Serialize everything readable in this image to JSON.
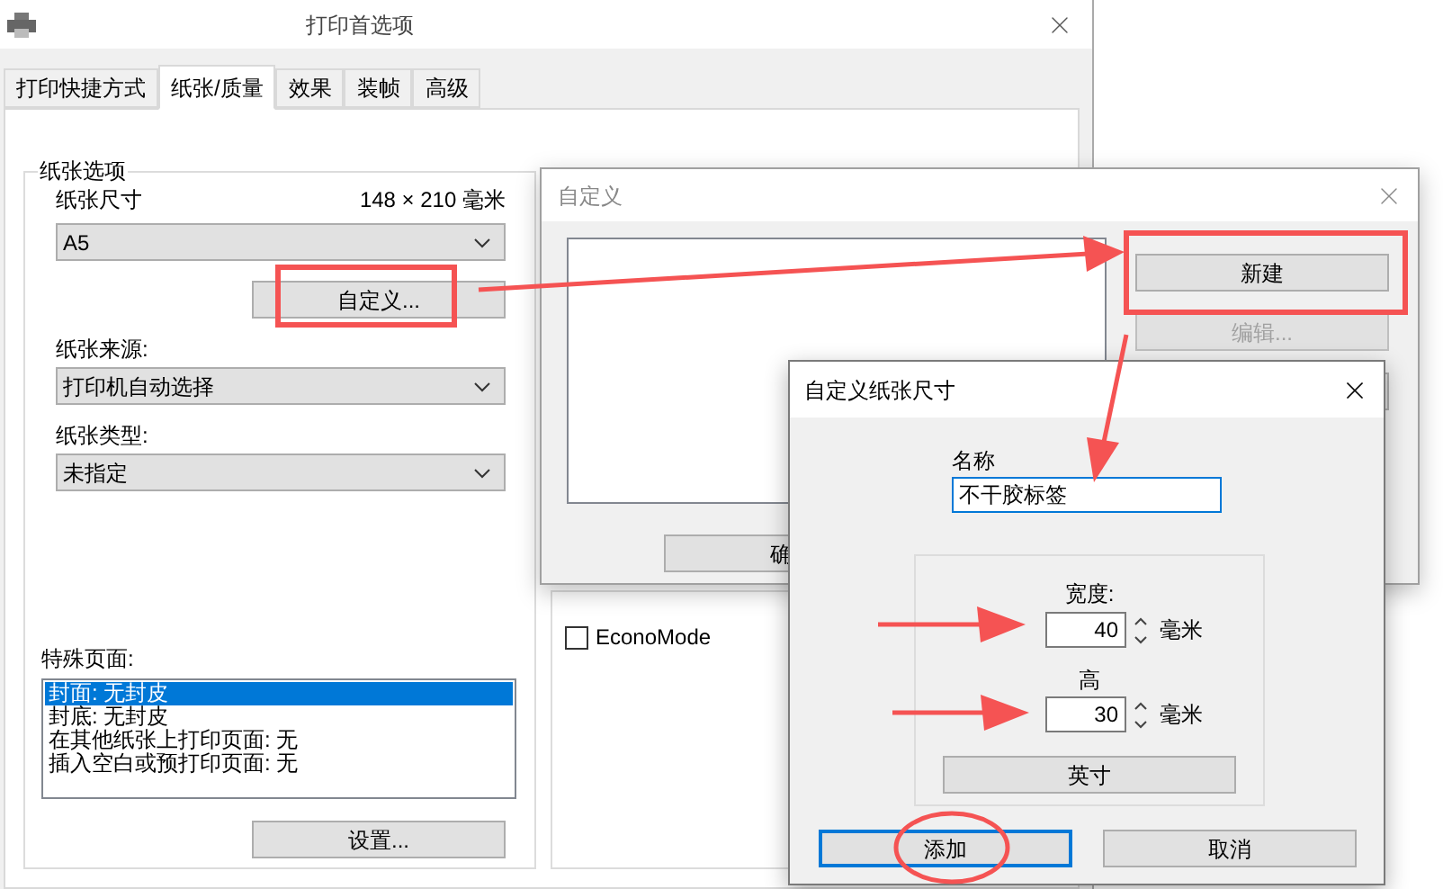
{
  "main_window": {
    "title": "打印首选项",
    "tabs": [
      {
        "label": "打印快捷方式",
        "selected": false
      },
      {
        "label": "纸张/质量",
        "selected": true
      },
      {
        "label": "效果",
        "selected": false
      },
      {
        "label": "装帧",
        "selected": false
      },
      {
        "label": "高级",
        "selected": false
      }
    ],
    "paper_options": {
      "group_title": "纸张选项",
      "size_label": "纸张尺寸",
      "size_reading": "148 × 210 毫米",
      "size_value": "A5",
      "custom_button": "自定义...",
      "source_label": "纸张来源:",
      "source_value": "打印机自动选择",
      "type_label": "纸张类型:",
      "type_value": "未指定",
      "special_pages_label": "特殊页面:",
      "special_pages": [
        {
          "text": "封面: 无封皮",
          "selected": true
        },
        {
          "text": "封底: 无封皮",
          "selected": false
        },
        {
          "text": "在其他纸张上打印页面: 无",
          "selected": false
        },
        {
          "text": "插入空白或预打印页面: 无",
          "selected": false
        }
      ],
      "settings_button": "设置..."
    },
    "econo_mode": {
      "label": "EconoMode",
      "checked": false
    }
  },
  "custom_dialog": {
    "title": "自定义",
    "buttons": [
      {
        "label": "新建",
        "disabled": false
      },
      {
        "label": "编辑...",
        "disabled": true
      }
    ],
    "ok_button": "确"
  },
  "paper_size_dialog": {
    "title": "自定义纸张尺寸",
    "name_label": "名称",
    "name_value": "不干胶标签",
    "width_label": "宽度:",
    "width_value": "40",
    "width_unit": "毫米",
    "height_label": "高",
    "height_value": "30",
    "height_unit": "毫米",
    "inch_button": "英寸",
    "add_button": "添加",
    "cancel_button": "取消"
  }
}
